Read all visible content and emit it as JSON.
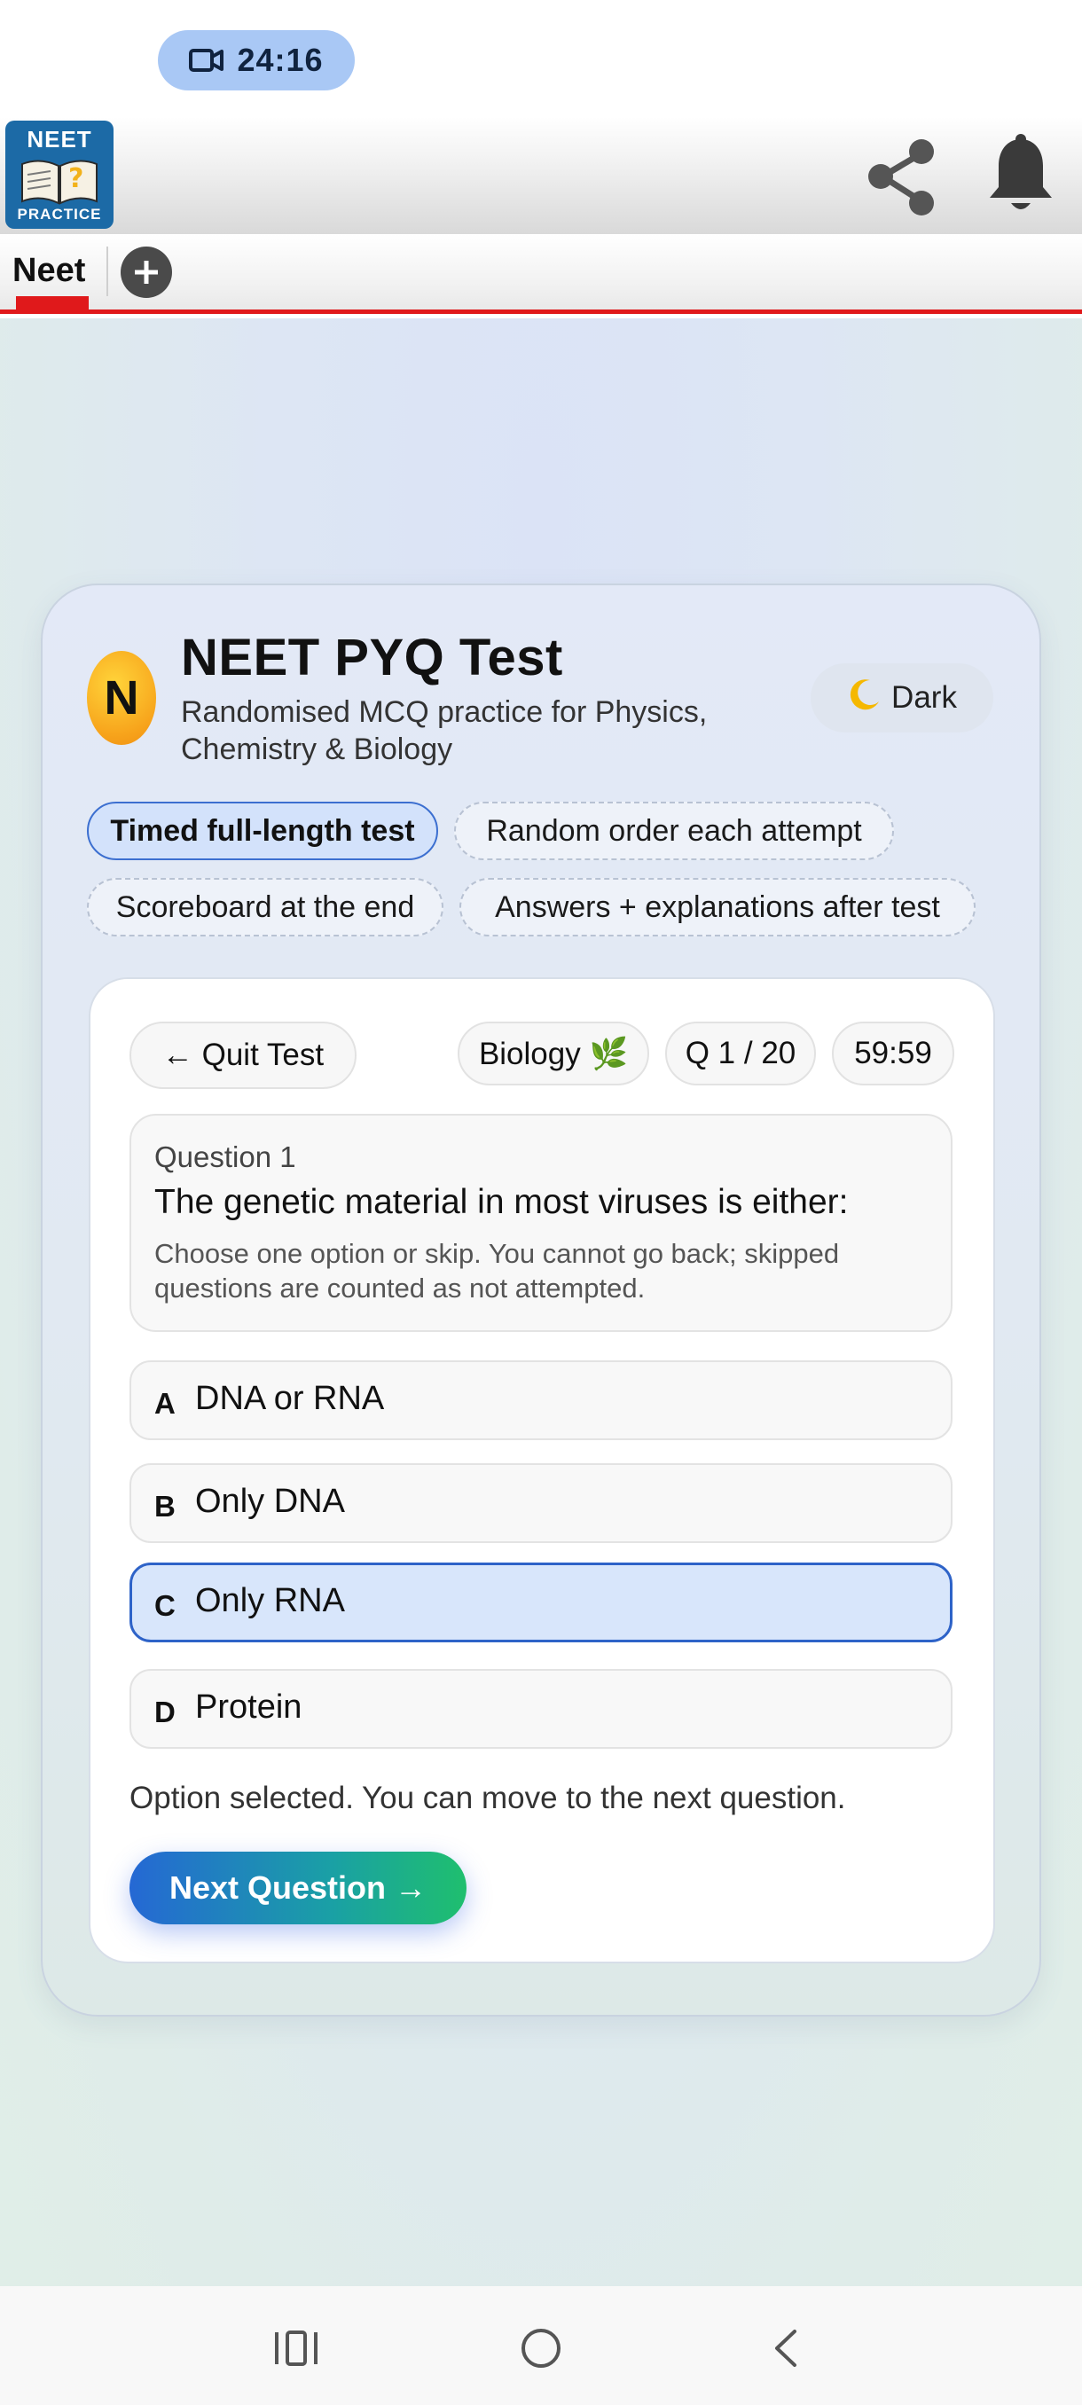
{
  "status_bar": {
    "recording_time": "24:16",
    "recording_icon": "video-camera-icon"
  },
  "app_header": {
    "logo": {
      "top_text": "NEET",
      "bottom_text": "PRACTICE"
    },
    "icons": [
      "share-icon",
      "bell-icon"
    ]
  },
  "tabs": {
    "items": [
      {
        "label": "Neet",
        "active": true
      }
    ],
    "add_icon": "plus-circle-icon"
  },
  "colors": {
    "accent_red": "#e0191b",
    "selected_blue": "#2e63c8",
    "badge_orange": "#f7a31b",
    "button_gradient_start": "#2568d4",
    "button_gradient_end": "#1fbf6e"
  },
  "test_card": {
    "badge_letter": "N",
    "title": "NEET PYQ Test",
    "subtitle": "Randomised MCQ practice for Physics, Chemistry & Biology",
    "theme_toggle": {
      "icon": "moon-icon",
      "label": "Dark"
    },
    "features": [
      {
        "label": "Timed full-length test",
        "active": true
      },
      {
        "label": "Random order each attempt",
        "active": false
      },
      {
        "label": "Scoreboard at the end",
        "active": false
      },
      {
        "label": "Answers + explanations after test",
        "active": false
      }
    ]
  },
  "quiz": {
    "quit_label": "← Quit Test",
    "subject": "Biology 🌿",
    "question_counter": "Q 1 / 20",
    "timer": "59:59",
    "question_label": "Question 1",
    "question_text": "The genetic material in most viruses is either:",
    "hint": "Choose one option or skip. You cannot go back; skipped questions are counted as not attempted.",
    "options": [
      {
        "letter": "A",
        "text": "DNA or RNA",
        "selected": false
      },
      {
        "letter": "B",
        "text": "Only DNA",
        "selected": false
      },
      {
        "letter": "C",
        "text": "Only RNA",
        "selected": true
      },
      {
        "letter": "D",
        "text": "Protein",
        "selected": false
      }
    ],
    "status_message": "Option selected. You can move to the next question.",
    "next_label": "Next Question →"
  },
  "nav_bar": {
    "icons": [
      "recents-icon",
      "home-icon",
      "back-icon"
    ]
  }
}
